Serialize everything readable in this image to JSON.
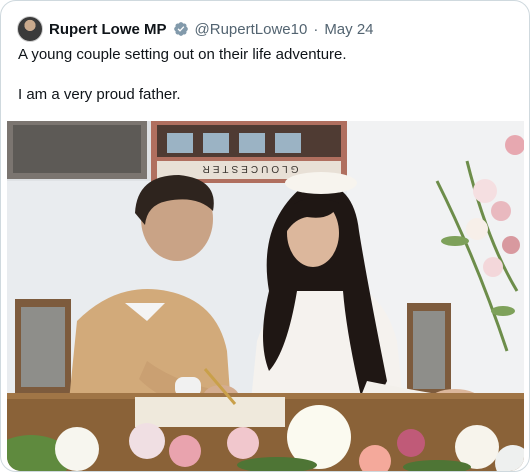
{
  "tweet": {
    "author_name": "Rupert Lowe MP",
    "handle": "@RupertLowe10",
    "separator": "·",
    "date": "May 24",
    "text_line1": "A young couple setting out on their life adventure.",
    "text_line2": "I am a very proud father."
  },
  "photo": {
    "sign_text": "GLOUCESTER"
  },
  "icons": {
    "verified": "verified-badge-icon",
    "avatar": "profile-avatar"
  },
  "colors": {
    "text": "#0f1419",
    "secondary": "#536471",
    "border": "#cfd9de",
    "verified_badge": "#829aab"
  }
}
